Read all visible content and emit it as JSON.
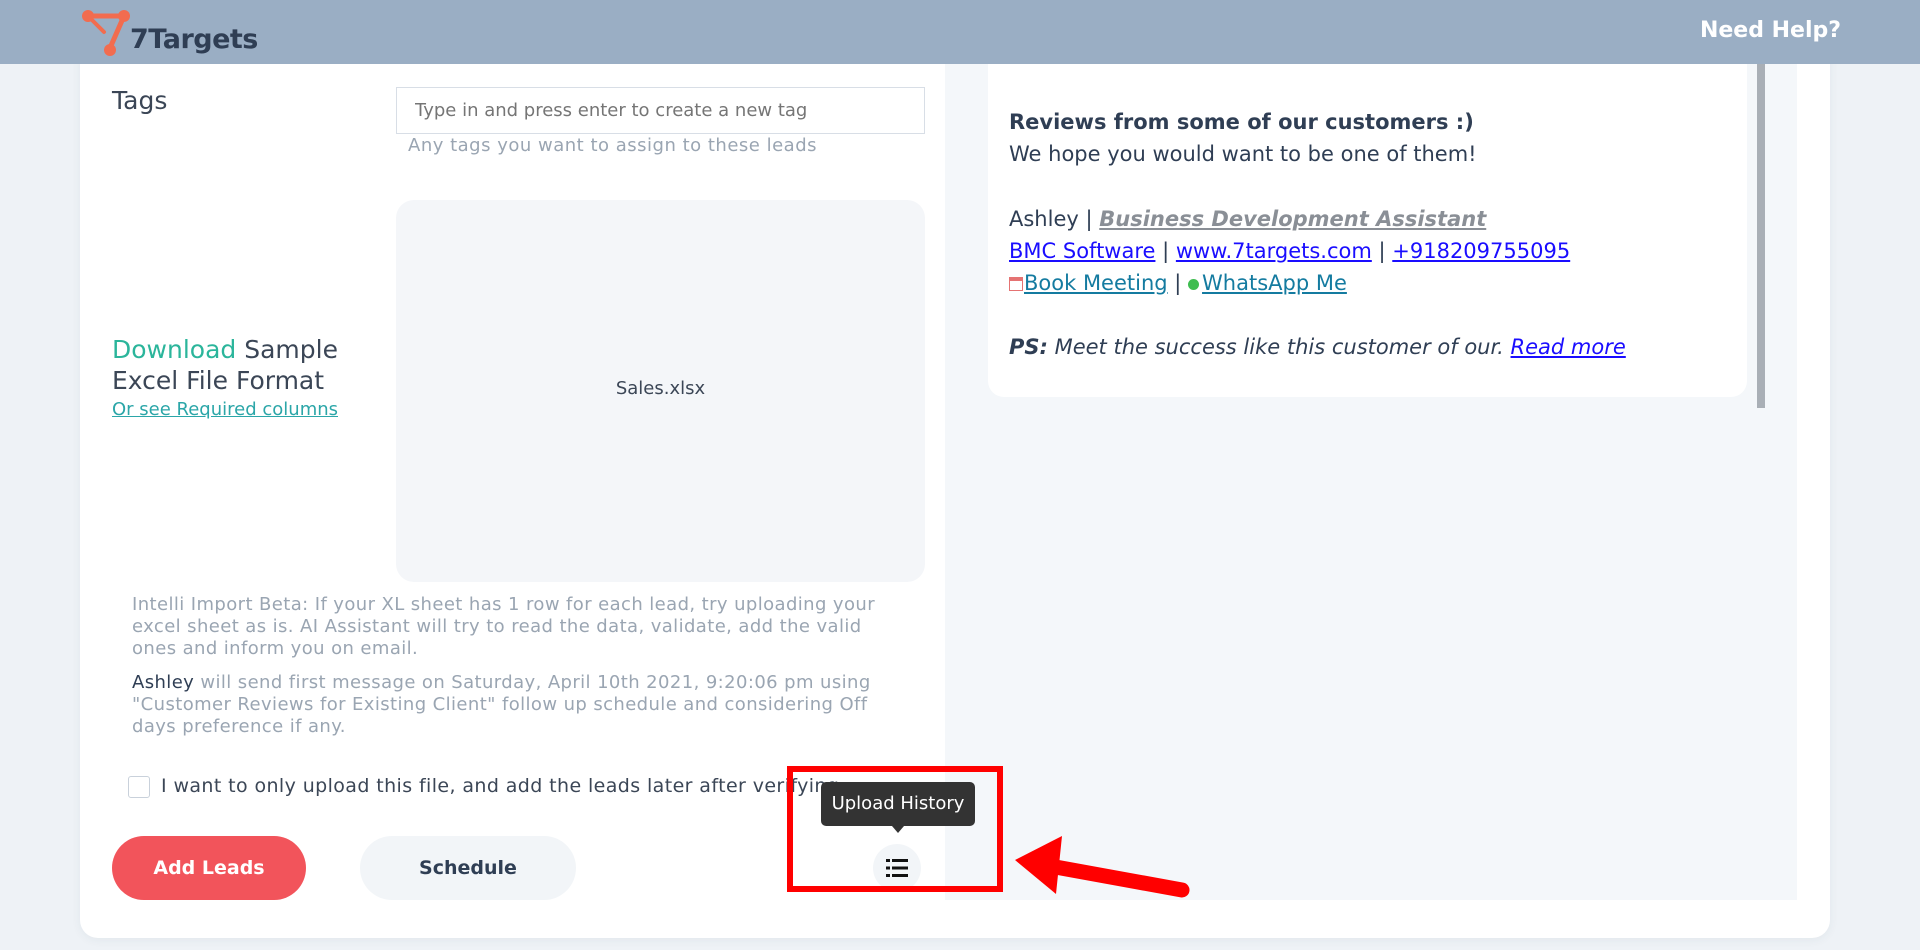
{
  "header": {
    "logo_text": "7Targets",
    "need_help": "Need Help?"
  },
  "tags": {
    "label": "Tags",
    "placeholder": "Type in and press enter to create a new tag",
    "help": "Any tags you want to assign to these leads"
  },
  "download": {
    "link_text": "Download",
    "rest_text": "Sample Excel File Format",
    "required_link": "Or see Required columns"
  },
  "upload": {
    "file_name": "Sales.xlsx"
  },
  "notes": {
    "intelli": "Intelli Import Beta: If your XL sheet has 1 row for each lead, try uploading your excel sheet as is. AI Assistant will try to read the data, validate, add the valid ones and inform you on email.",
    "owner": "Ashley",
    "schedule_text": " will send first message on Saturday, April 10th 2021, 9:20:06 pm using \"Customer Reviews for Existing Client\" follow up schedule and considering Off days preference if any."
  },
  "checkbox": {
    "label": "I want to only upload this file, and add the leads later after verifying",
    "checked": false
  },
  "buttons": {
    "add_leads": "Add Leads",
    "schedule": "Schedule"
  },
  "history": {
    "tooltip": "Upload History",
    "icon": "list-icon"
  },
  "preview": {
    "heading": "Reviews from some of our customers :)",
    "line2": "We hope you would want to be one of them!",
    "sig_name": "Ashley",
    "sep": " | ",
    "sig_role": "Business Development Assistant",
    "company": "BMC Software",
    "website": "www.7targets.com",
    "phone": " +918209755095",
    "book": "Book Meeting",
    "whatsapp": "WhatsApp Me",
    "ps_label": "PS:",
    "ps_text": " Meet the success like this customer of our. ",
    "read_more": "Read more"
  },
  "colors": {
    "header_bg": "#9aaec4",
    "add_leads_bg": "#f2545b",
    "download_link": "#2bb59b",
    "annotation_red": "#ff0000"
  }
}
